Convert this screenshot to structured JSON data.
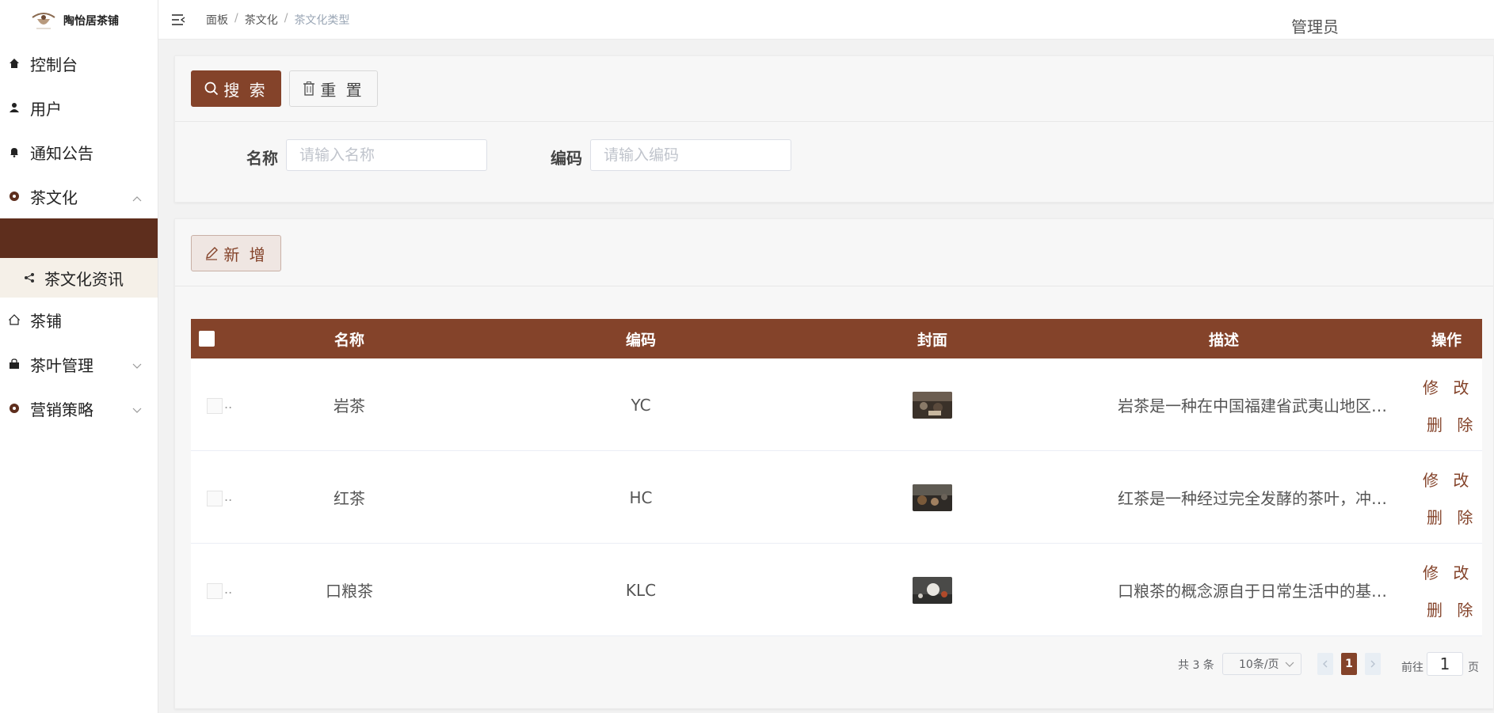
{
  "app": {
    "name": "陶怡居茶铺"
  },
  "header": {
    "breadcrumb": [
      "面板",
      "茶文化",
      "茶文化类型"
    ],
    "user": "管理员"
  },
  "sidebar": {
    "items": [
      {
        "label": "控制台",
        "icon": "home-icon"
      },
      {
        "label": "用户",
        "icon": "user-icon"
      },
      {
        "label": "通知公告",
        "icon": "bell-icon"
      },
      {
        "label": "茶文化",
        "icon": "circle-icon",
        "expanded": true
      },
      {
        "label": "茶铺",
        "icon": "house-icon"
      },
      {
        "label": "茶叶管理",
        "icon": "bag-icon",
        "expanded": false
      },
      {
        "label": "营销策略",
        "icon": "circle-icon",
        "expanded": false
      }
    ],
    "submenu": {
      "label": "茶文化资讯",
      "icon": "share-icon"
    }
  },
  "search": {
    "search_button": "搜 索",
    "reset_button": "重 置",
    "name_label": "名称",
    "name_placeholder": "请输入名称",
    "code_label": "编码",
    "code_placeholder": "请输入编码"
  },
  "toolbar": {
    "add_button": "新 增"
  },
  "table": {
    "columns": [
      "名称",
      "编码",
      "封面",
      "描述",
      "操作"
    ],
    "rows": [
      {
        "name": "岩茶",
        "code": "YC",
        "description": "岩茶是一种在中国福建省武夷山地区…"
      },
      {
        "name": "红茶",
        "code": "HC",
        "description": "红茶是一种经过完全发酵的茶叶，冲…"
      },
      {
        "name": "口粮茶",
        "code": "KLC",
        "description": "口粮茶的概念源自于日常生活中的基…"
      }
    ],
    "actions": {
      "edit": "修 改",
      "delete": "删 除"
    }
  },
  "pagination": {
    "total_text": "共 3 条",
    "page_size": "10条/页",
    "current_page": "1",
    "goto_label": "前往",
    "goto_value": "1",
    "page_suffix": "页"
  },
  "colors": {
    "accent": "#84432a",
    "sidebar_active": "#5e2e1d"
  }
}
